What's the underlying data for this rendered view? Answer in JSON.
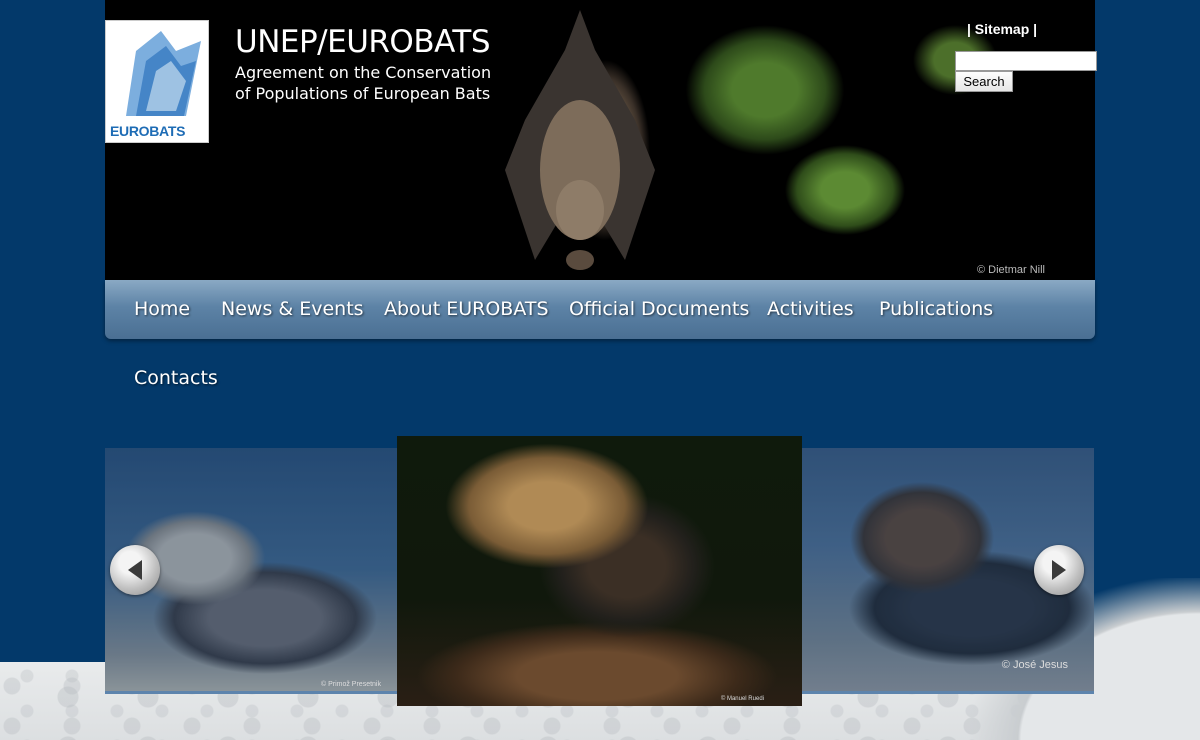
{
  "header": {
    "title": "UNEP/EUROBATS",
    "subtitle_line1": "Agreement on the Conservation",
    "subtitle_line2": "of Populations of European Bats",
    "logo_text": "EUROBATS",
    "photo_credit": "© Dietmar Nill",
    "sitemap_label": "| Sitemap |",
    "search_placeholder": "",
    "search_button": "Search"
  },
  "nav": {
    "items": [
      {
        "label": "Home"
      },
      {
        "label": "News & Events"
      },
      {
        "label": "About EUROBATS"
      },
      {
        "label": "Official Documents"
      },
      {
        "label": "Activities"
      },
      {
        "label": "Publications"
      },
      {
        "label": "Contacts"
      }
    ]
  },
  "carousel": {
    "credits": [
      "© Primož Presetnik",
      "© Manuel Ruedi",
      "© José Jesus"
    ],
    "prev_icon": "arrow-left-icon",
    "next_icon": "arrow-right-icon"
  },
  "colors": {
    "background": "#03396a",
    "nav_gradient_top": "#8aa9c4",
    "nav_gradient_bottom": "#4a6f93"
  }
}
